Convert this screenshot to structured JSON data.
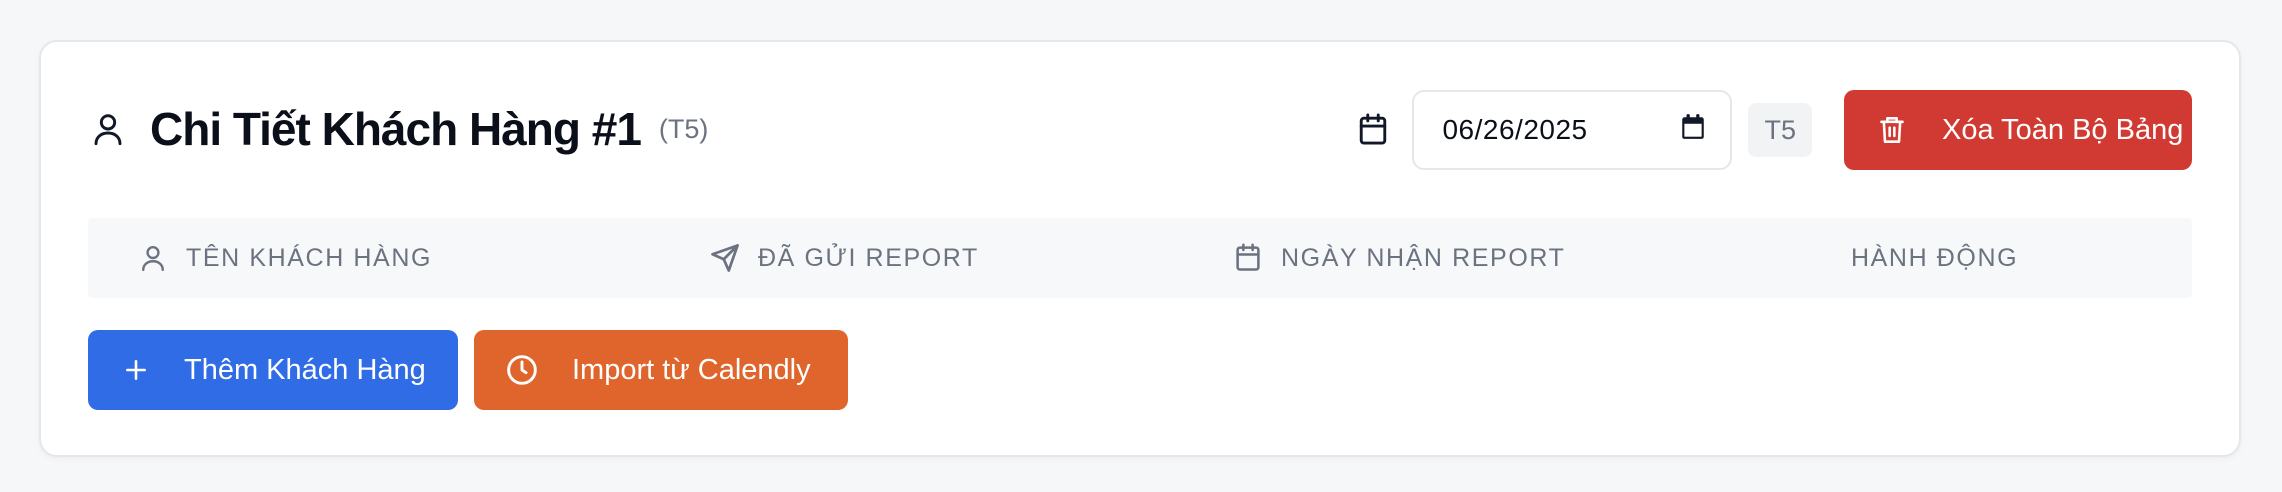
{
  "header": {
    "title": "Chi Tiết Khách Hàng #1",
    "subtitle": "(T5)",
    "title_icon": "user-icon"
  },
  "controls": {
    "calendar_icon": "calendar-icon",
    "date_value": "06/26/2025",
    "badge": "T5",
    "delete_all_label": "Xóa Toàn Bộ Bảng",
    "delete_icon": "trash-icon"
  },
  "table": {
    "columns": [
      {
        "label": "TÊN KHÁCH HÀNG",
        "icon": "user-icon"
      },
      {
        "label": "ĐÃ GỬI REPORT",
        "icon": "send-icon"
      },
      {
        "label": "NGÀY NHẬN REPORT",
        "icon": "calendar-icon"
      },
      {
        "label": "HÀNH ĐỘNG",
        "icon": ""
      }
    ]
  },
  "actions": {
    "add_customer_label": "Thêm Khách Hàng",
    "add_icon": "plus-icon",
    "import_label": "Import từ Calendly",
    "import_icon": "clock-icon"
  },
  "colors": {
    "primary": "#2f6ce5",
    "danger": "#d13a32",
    "orange": "#e0652c",
    "muted_text": "#6b7280"
  }
}
